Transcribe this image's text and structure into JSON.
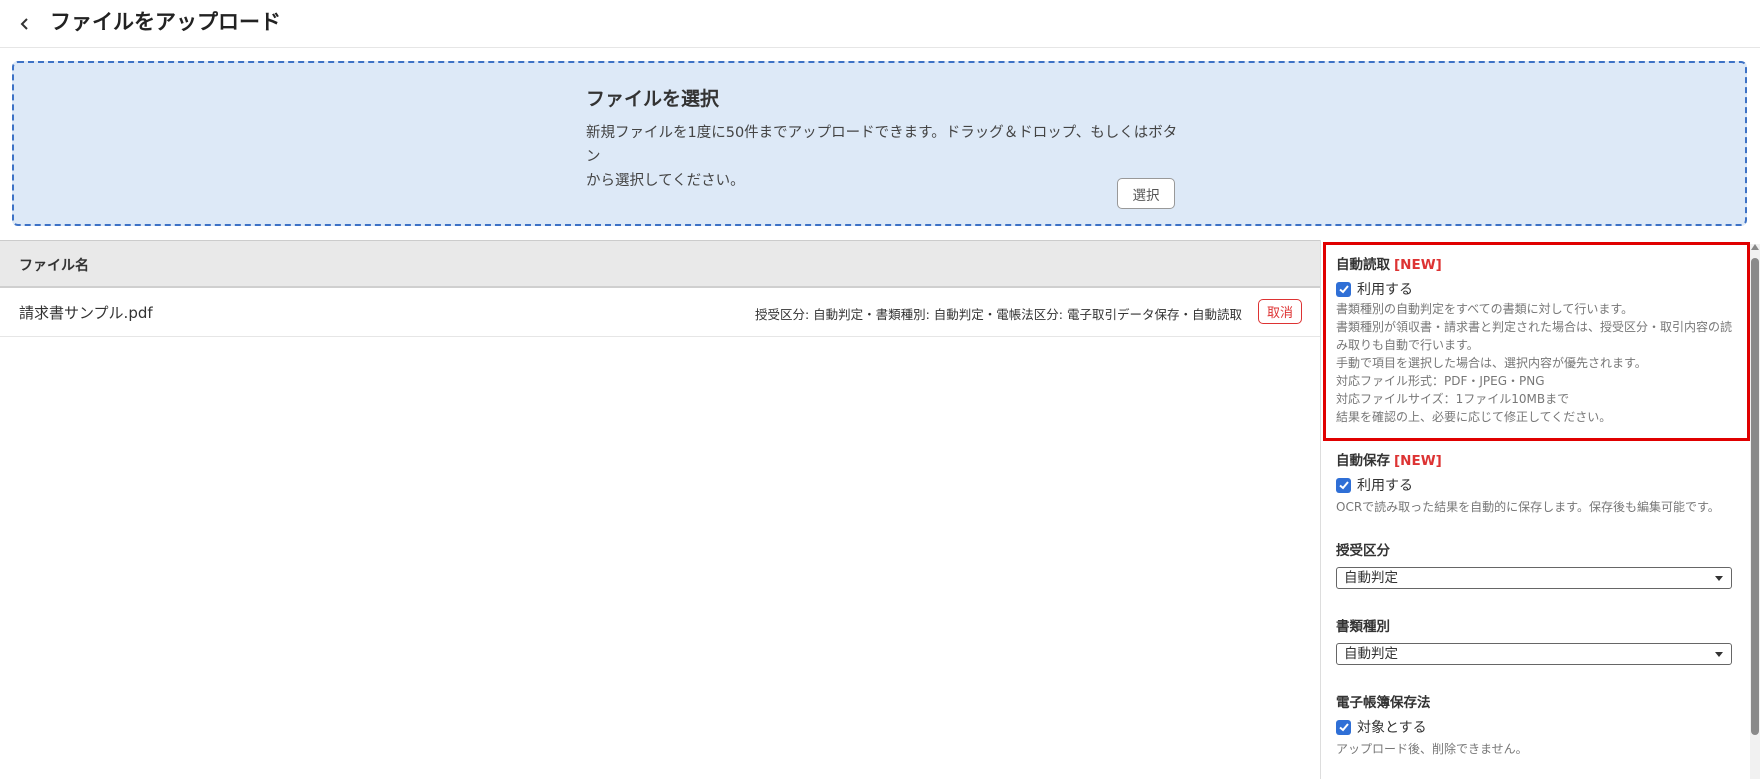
{
  "header": {
    "title": "ファイルをアップロード",
    "back_icon": "chevron-left-icon"
  },
  "dropzone": {
    "title": "ファイルを選択",
    "description_line1": "新規ファイルを1度に50件までアップロードできます。ドラッグ＆ドロップ、もしくはボタン",
    "description_line2": "から選択してください。",
    "select_button": "選択"
  },
  "table": {
    "header_filename": "ファイル名",
    "rows": [
      {
        "filename": "請求書サンプル.pdf",
        "attributes": "授受区分: 自動判定・書類種別: 自動判定・電帳法区分: 電子取引データ保存・自動読取",
        "cancel": "取消"
      }
    ]
  },
  "side_panel": {
    "auto_read": {
      "title": "自動読取",
      "badge": "[NEW]",
      "checkbox_label": "利用する",
      "help": [
        "書類種別の自動判定をすべての書類に対して行います。",
        "書類種別が領収書・請求書と判定された場合は、授受区分・取引内容の読",
        "み取りも自動で行います。",
        "手動で項目を選択した場合は、選択内容が優先されます。",
        "対応ファイル形式：PDF・JPEG・PNG",
        "対応ファイルサイズ：1ファイル10MBまで",
        "結果を確認の上、必要に応じて修正してください。"
      ]
    },
    "auto_save": {
      "title": "自動保存",
      "badge": "[NEW]",
      "checkbox_label": "利用する",
      "help": "OCRで読み取った結果を自動的に保存します。保存後も編集可能です。"
    },
    "transfer_type": {
      "title": "授受区分",
      "value": "自動判定"
    },
    "doc_type": {
      "title": "書類種別",
      "value": "自動判定"
    },
    "ebook_law": {
      "title": "電子帳簿保存法",
      "checkbox_label": "対象とする",
      "help": "アップロード後、削除できません。"
    }
  },
  "colors": {
    "accent": "#2f6fd6",
    "danger": "#d33333",
    "highlight": "#e00000",
    "dropzone_bg": "#dde9f7"
  }
}
